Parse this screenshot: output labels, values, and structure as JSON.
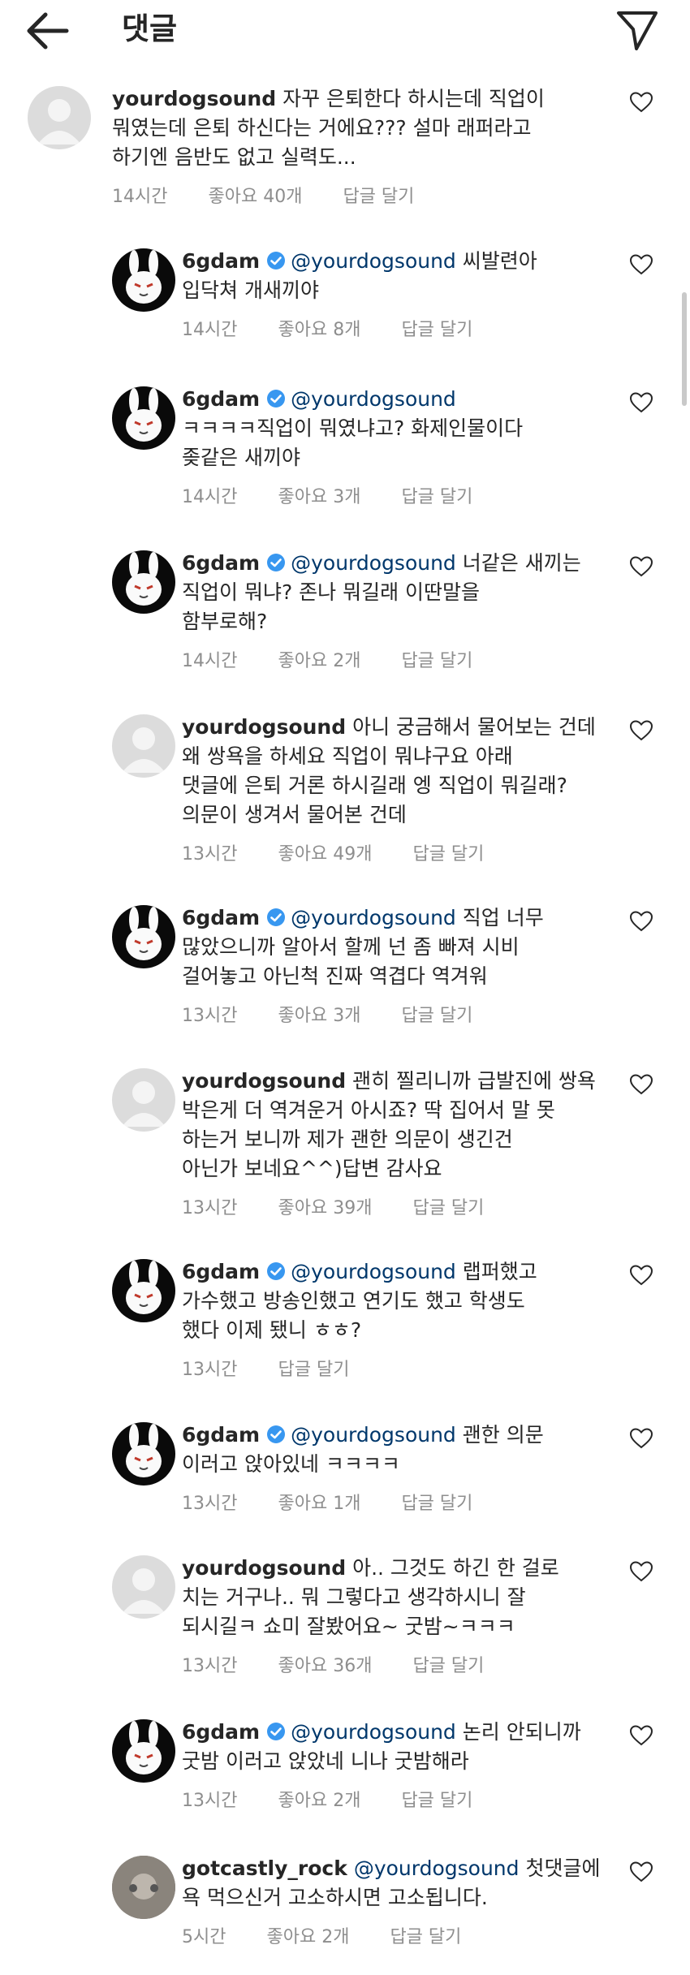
{
  "header": {
    "title": "댓글",
    "back_icon": "arrow-left-icon",
    "share_icon": "send-icon"
  },
  "comments": [
    {
      "user": "yourdogsound",
      "verified": false,
      "mention": "",
      "lines": [
        "자꾸 은퇴한다 하시는데 직업이",
        "뭐였는데 은퇴 하신다는 거에요??? 설마 래퍼라고",
        "하기엔 음반도 없고 실력도..."
      ],
      "time": "14시간",
      "likes": "좋아요 40개",
      "reply": "답글 달기"
    },
    {
      "user": "6gdam",
      "verified": true,
      "mention": "@yourdogsound",
      "lines": [
        "씨발련아",
        "입닥쳐 개새끼야"
      ],
      "time": "14시간",
      "likes": "좋아요 8개",
      "reply": "답글 달기"
    },
    {
      "user": "6gdam",
      "verified": true,
      "mention": "@yourdogsound",
      "lines": [
        "",
        "ㅋㅋㅋㅋ직업이 뭐였냐고? 화제인물이다",
        "좆같은 새끼야"
      ],
      "time": "14시간",
      "likes": "좋아요 3개",
      "reply": "답글 달기"
    },
    {
      "user": "6gdam",
      "verified": true,
      "mention": "@yourdogsound",
      "lines": [
        "너같은 새끼는",
        "직업이 뭐냐? 존나 뭐길래 이딴말을",
        "함부로해?"
      ],
      "time": "14시간",
      "likes": "좋아요 2개",
      "reply": "답글 달기"
    },
    {
      "user": "yourdogsound",
      "verified": false,
      "mention": "",
      "lines": [
        "아니 궁금해서 물어보는 건데",
        "왜 쌍욕을 하세요 직업이 뭐냐구요 아래",
        "댓글에 은퇴 거론 하시길래 엥 직업이 뭐길래?",
        "의문이 생겨서 물어본 건데"
      ],
      "time": "13시간",
      "likes": "좋아요 49개",
      "reply": "답글 달기"
    },
    {
      "user": "6gdam",
      "verified": true,
      "mention": "@yourdogsound",
      "lines": [
        "직업 너무",
        "많았으니까 알아서 할께 넌 좀 빠져 시비",
        "걸어놓고 아닌척 진짜 역겹다 역겨워"
      ],
      "time": "13시간",
      "likes": "좋아요 3개",
      "reply": "답글 달기"
    },
    {
      "user": "yourdogsound",
      "verified": false,
      "mention": "",
      "lines": [
        "괜히 찔리니까 급발진에 쌍욕",
        "박은게 더 역겨운거 아시죠? 딱 집어서 말 못",
        "하는거 보니까 제가 괜한 의문이 생긴건",
        "아닌가 보네요^^)답변 감사요"
      ],
      "time": "13시간",
      "likes": "좋아요 39개",
      "reply": "답글 달기"
    },
    {
      "user": "6gdam",
      "verified": true,
      "mention": "@yourdogsound",
      "lines": [
        "랩퍼했고",
        "가수했고 방송인했고 연기도 했고 학생도",
        "했다 이제 됐니 ㅎㅎ?"
      ],
      "time": "13시간",
      "likes": "",
      "reply": "답글 달기"
    },
    {
      "user": "6gdam",
      "verified": true,
      "mention": "@yourdogsound",
      "lines": [
        "괜한 의문",
        "이러고 앉아있네 ㅋㅋㅋㅋ"
      ],
      "time": "13시간",
      "likes": "좋아요 1개",
      "reply": "답글 달기"
    },
    {
      "user": "yourdogsound",
      "verified": false,
      "mention": "",
      "lines": [
        "아.. 그것도 하긴 한 걸로",
        "치는 거구나.. 뭐 그렇다고 생각하시니 잘",
        "되시길ㅋ 쇼미 잘봤어요~ 굿밤~ㅋㅋㅋ"
      ],
      "time": "13시간",
      "likes": "좋아요 36개",
      "reply": "답글 달기"
    },
    {
      "user": "6gdam",
      "verified": true,
      "mention": "@yourdogsound",
      "lines": [
        "논리 안되니까",
        "굿밤 이러고 앉았네 니나 굿밤해라"
      ],
      "time": "13시간",
      "likes": "좋아요 2개",
      "reply": "답글 달기"
    },
    {
      "user": "gotcastly_rock",
      "verified": false,
      "mention": "@yourdogsound",
      "lines": [
        "첫댓글에",
        "욕 먹으신거 고소하시면 고소됩니다."
      ],
      "time": "5시간",
      "likes": "좋아요 2개",
      "reply": "답글 달기"
    }
  ],
  "icons": {
    "heart": "heart-outline-icon",
    "verified": "verified-badge-icon"
  },
  "colors": {
    "text": "#262626",
    "meta": "#8e8e8e",
    "mention": "#00376b",
    "verified": "#3897f0"
  }
}
